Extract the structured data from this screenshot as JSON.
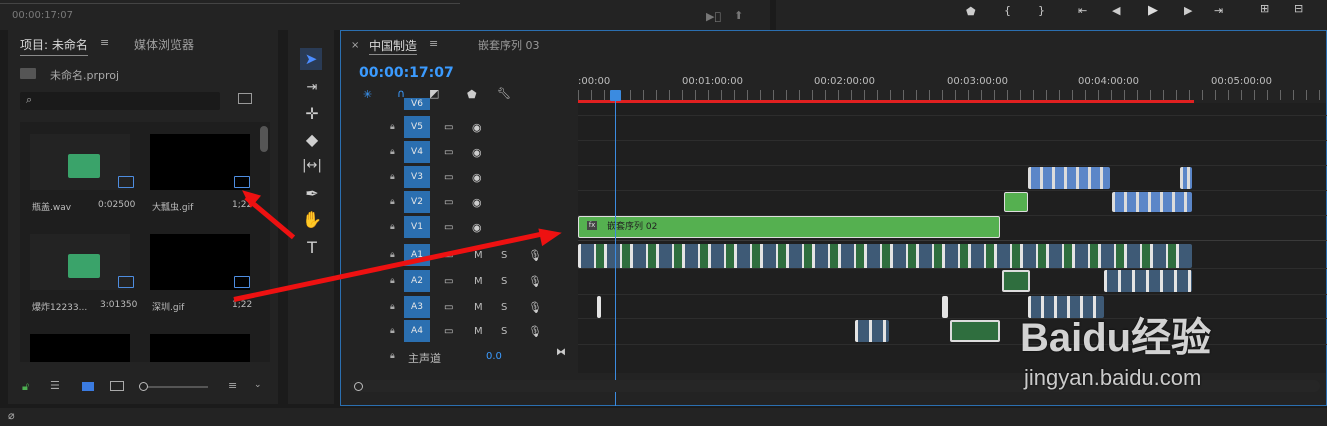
{
  "source_monitor": {
    "timecode": "00:00:17:07"
  },
  "project_panel": {
    "tab_project": "项目: 未命名",
    "tab_media": "媒体浏览器",
    "project_file": "未命名.prproj",
    "items": [
      {
        "name": "瓶盖.wav",
        "duration": "0:02500"
      },
      {
        "name": "大瓢虫.gif",
        "duration": "1;22"
      },
      {
        "name": "爆炸12233...",
        "duration": "3:01350"
      },
      {
        "name": "深圳.gif",
        "duration": "1;22"
      }
    ]
  },
  "timeline": {
    "tab_active": "中国制造",
    "tab_other": "嵌套序列 03",
    "timecode": "00:00:17:07",
    "ruler": [
      ":00:00",
      "00:01:00:00",
      "00:02:00:00",
      "00:03:00:00",
      "00:04:00:00",
      "00:05:00:00"
    ],
    "video_tracks": [
      "V6",
      "V5",
      "V4",
      "V3",
      "V2",
      "V1"
    ],
    "audio_tracks": [
      "A1",
      "A2",
      "A3",
      "A4"
    ],
    "audio_m": "M",
    "audio_s": "S",
    "master_label": "主声道",
    "master_value": "0.0",
    "nested_clip_label": "嵌套序列 02",
    "fx_label": "fx"
  },
  "watermark": {
    "brand": "Baidu经验",
    "url": "jingyan.baidu.com"
  },
  "colors": {
    "accent": "#2b6fb0",
    "green_clip": "#55b050",
    "playhead": "#3b8be0",
    "annotation_arrow": "#ee1111"
  }
}
